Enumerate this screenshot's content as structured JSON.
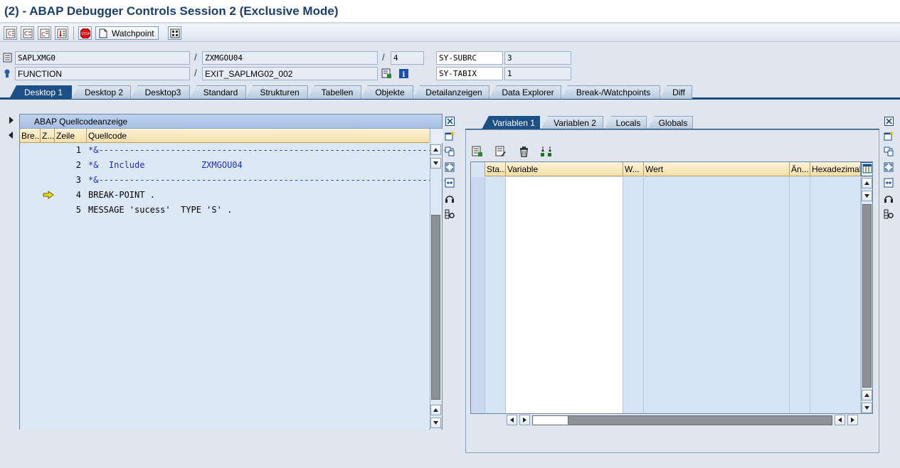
{
  "window": {
    "title": "(2) - ABAP Debugger Controls Session 2 (Exclusive Mode)"
  },
  "toolbar": {
    "buttons": [
      {
        "name": "single-step-button",
        "icon": "single-step-icon"
      },
      {
        "name": "execute-button",
        "icon": "execute-icon"
      },
      {
        "name": "return-button",
        "icon": "return-icon"
      },
      {
        "name": "continue-button",
        "icon": "continue-icon"
      },
      {
        "name": "stop-button",
        "icon": "stop-icon"
      }
    ],
    "watchpoint_label": "Watchpoint"
  },
  "info": {
    "program": "SAPLXMG0",
    "include": "ZXMGOU04",
    "line": "4",
    "event_type": "FUNCTION",
    "event": "EXIT_SAPLMG02_002",
    "sysfield1_name": "SY-SUBRC",
    "sysfield1_value": "3",
    "sysfield2_name": "SY-TABIX",
    "sysfield2_value": "1"
  },
  "tabs": [
    "Desktop 1",
    "Desktop 2",
    "Desktop3",
    "Standard",
    "Strukturen",
    "Tabellen",
    "Objekte",
    "Detailanzeigen",
    "Data Explorer",
    "Break-/Watchpoints",
    "Diff"
  ],
  "source_panel": {
    "title": "ABAP Quellcodeanzeige",
    "columns": [
      "Bre...",
      "Z...",
      "Zeile",
      "Quellcode"
    ],
    "lines": [
      {
        "num": "1",
        "code": "*&---------------------------------------------------------------------",
        "comment": true
      },
      {
        "num": "2",
        "code": "*&  Include           ZXMGOU04",
        "comment": true
      },
      {
        "num": "3",
        "code": "*&---------------------------------------------------------------------",
        "comment": true
      },
      {
        "num": "4",
        "code": "BREAK-POINT .",
        "comment": false,
        "current": true
      },
      {
        "num": "5",
        "code": "MESSAGE 'sucess'  TYPE 'S' .",
        "comment": false
      }
    ]
  },
  "variables_panel": {
    "tabs": [
      "Variablen 1",
      "Variablen 2",
      "Locals",
      "Globals"
    ],
    "columns": [
      "Sta...",
      "Variable",
      "W...",
      "Wert",
      "Än...",
      "Hexadezimalwert"
    ],
    "row_count": 16
  },
  "colors": {
    "accent": "#1d5086",
    "comment": "#1d2ed6",
    "header": "#f3dfa8"
  }
}
